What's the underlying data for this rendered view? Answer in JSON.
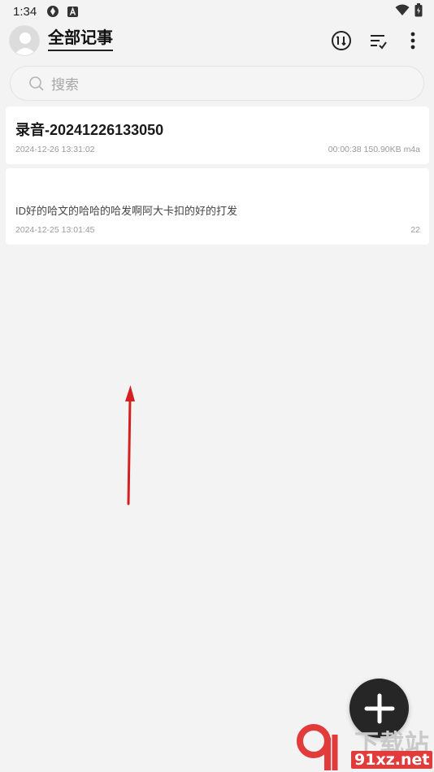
{
  "status_bar": {
    "time": "1:34",
    "icons": [
      "sync-icon",
      "a-badge-icon",
      "wifi-icon",
      "battery-icon"
    ]
  },
  "header": {
    "title": "全部记事",
    "actions": [
      "sort-numbers-icon",
      "list-filter-icon",
      "more-icon"
    ]
  },
  "search": {
    "placeholder": "搜索"
  },
  "notes": [
    {
      "title": "录音-20241226133050",
      "date": "2024-12-26 13:31:02",
      "meta": "00:00:38 150.90KB m4a"
    },
    {
      "body": "ID好的哈文的哈哈的哈发啊阿大卡扣的好的打发",
      "date": "2024-12-25 13:01:45",
      "meta": "22"
    }
  ],
  "watermark": {
    "cn": "下载站",
    "url": "91xz.net"
  },
  "colors": {
    "background": "#f3f3f3",
    "card": "#ffffff",
    "fab": "#262626",
    "arrow": "#d61f1f",
    "watermark_red": "#e23b3b"
  }
}
